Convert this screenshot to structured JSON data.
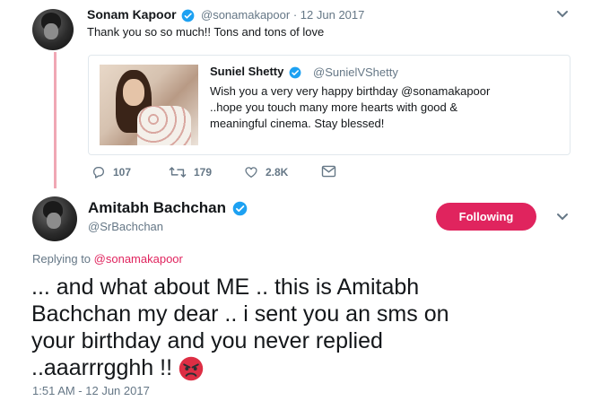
{
  "reply_tweet": {
    "author_name": "Sonam Kapoor",
    "author_handle": "@sonamakapoor",
    "separator": "·",
    "date": "12 Jun 2017",
    "text": "Thank you so so much!! Tons and tons of love",
    "quoted": {
      "author_name": "Suniel Shetty",
      "author_handle": "@SunielVShetty",
      "line1": "Wish you a very very happy birthday @sonamakapoor",
      "line2": "..hope you touch many more hearts with good &",
      "line3": "meaningful cinema. Stay blessed!"
    },
    "actions": {
      "replies": "107",
      "retweets": "179",
      "likes": "2.8K"
    }
  },
  "main_tweet": {
    "author_name": "Amitabh Bachchan",
    "author_handle": "@SrBachchan",
    "follow_label": "Following",
    "replying_prefix": "Replying to",
    "replying_to": "@sonamakapoor",
    "line1": "... and what about ME .. this is Amitabh",
    "line2": "Bachchan my dear .. i sent you an sms on",
    "line3": "your birthday and you never replied",
    "line4": "..aaarrrgghh !!",
    "timestamp": "1:51 AM - 12 Jun 2017"
  },
  "colors": {
    "verified": "#1da1f2",
    "follow_button": "#e0245e",
    "thread_line": "#f0a7b4",
    "angry_emoji": "#dd2e44"
  }
}
